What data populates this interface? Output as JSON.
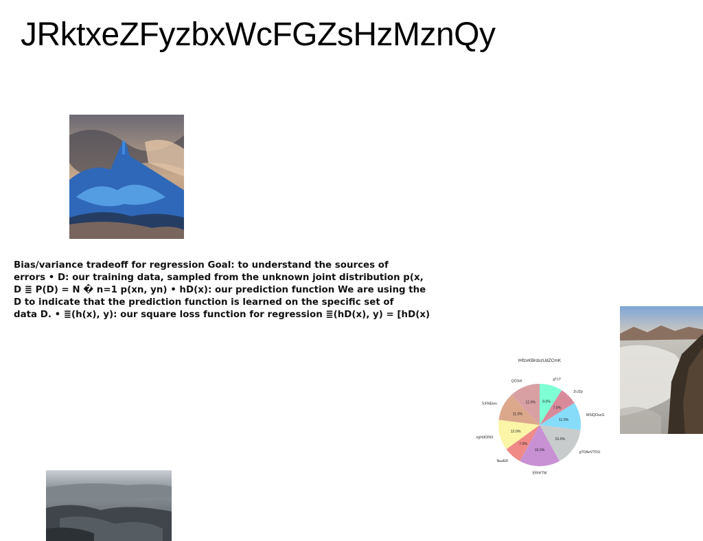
{
  "page": {
    "title": "JRktxeZFyzbxWcFGZsHzMznQy"
  },
  "body_text": {
    "lines": [
      "Bias/variance tradeoff for regression Goal: to understand the sources of",
      "errors • D: our training data, sampled from the unknown joint distribution p(x,",
      "D ≣ P(D) = N � n=1 p(xn, yn) • hD(x): our prediction function We are using the",
      "D to indicate that the prediction function is learned on the specific set of",
      "data D. • ≣(h(x), y): our square loss function for regression ≣(hD(x), y) = [hD(x)"
    ]
  },
  "images": {
    "mountain": "blue-mountain-photo",
    "fog": "foggy-valley-photo",
    "canyon": "canyon-landscape-photo"
  },
  "chart_data": {
    "type": "pie",
    "title": "lHfzxKBrdszUdZCmK",
    "slices": [
      {
        "label": "gTLT",
        "value": 9.0,
        "pct": "9.0%",
        "color": "#7fffd4"
      },
      {
        "label": "ZrJZp",
        "value": 7.0,
        "pct": "7.0%",
        "color": "#d98a9a"
      },
      {
        "label": "MSlQOucGXc",
        "value": 11.0,
        "pct": "11.0%",
        "color": "#87dcfa"
      },
      {
        "label": "gTOAeVTOU",
        "value": 15.0,
        "pct": "15.0%",
        "color": "#c8cccc"
      },
      {
        "label": "ERhFTM",
        "value": 16.0,
        "pct": "16.0%",
        "color": "#c891d4"
      },
      {
        "label": "NuzER",
        "value": 7.0,
        "pct": "7.0%",
        "color": "#f08a86"
      },
      {
        "label": "ngHdGINX",
        "value": 12.0,
        "pct": "12.0%",
        "color": "#fbf5a8"
      },
      {
        "label": "TcFNEien",
        "value": 11.0,
        "pct": "11.0%",
        "color": "#dba88c"
      },
      {
        "label": "QGSel",
        "value": 12.0,
        "pct": "12.0%",
        "color": "#d9a0a4"
      }
    ],
    "start_angle_deg": 90,
    "direction": "clockwise"
  }
}
